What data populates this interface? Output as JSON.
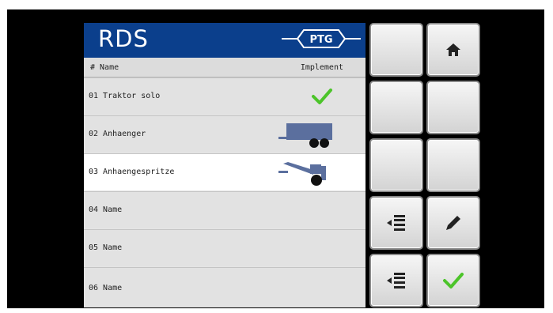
{
  "app": {
    "title": "RDS",
    "brand": "PTG"
  },
  "table": {
    "columns": [
      "# Name",
      "Implement"
    ],
    "rows": [
      {
        "label": "01 Traktor solo",
        "implement": "check-icon",
        "selected": false
      },
      {
        "label": "02 Anhaenger",
        "implement": "trailer-icon",
        "selected": false
      },
      {
        "label": "03 Anhaengespritze",
        "implement": "sprayer-trailer-icon",
        "selected": true
      },
      {
        "label": "04 Name",
        "implement": "",
        "selected": false
      },
      {
        "label": "05 Name",
        "implement": "",
        "selected": false
      },
      {
        "label": "06 Name",
        "implement": "",
        "selected": false
      }
    ]
  },
  "softkeys": [
    {
      "icon": "",
      "name": "softkey-empty-1"
    },
    {
      "icon": "home-icon",
      "name": "home-button"
    },
    {
      "icon": "",
      "name": "softkey-empty-2"
    },
    {
      "icon": "",
      "name": "softkey-empty-3"
    },
    {
      "icon": "",
      "name": "softkey-empty-4"
    },
    {
      "icon": "",
      "name": "softkey-empty-5"
    },
    {
      "icon": "insert-row-icon",
      "name": "insert-row-button"
    },
    {
      "icon": "pencil-icon",
      "name": "edit-button"
    },
    {
      "icon": "insert-row-icon",
      "name": "insert-row-button-2"
    },
    {
      "icon": "check-icon",
      "name": "confirm-button"
    }
  ],
  "colors": {
    "header": "#0b3f8c",
    "accent_green": "#4cc42a",
    "implement_blue": "#5b6f9e"
  }
}
